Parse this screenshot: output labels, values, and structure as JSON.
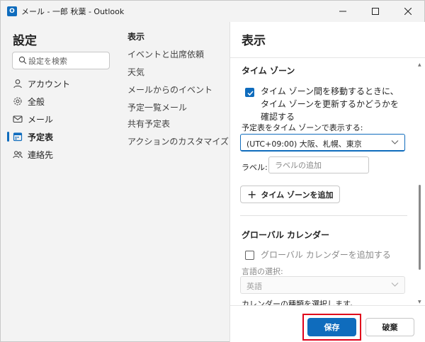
{
  "window": {
    "title": "メール - 一郎 秋葉 - Outlook",
    "app_icon_letter": "O",
    "minimize_icon": "minimize-icon",
    "maximize_icon": "maximize-icon",
    "close_icon": "close-icon"
  },
  "nav": {
    "title": "設定",
    "search_placeholder": "設定を検索",
    "items": [
      {
        "label": "アカウント",
        "icon": "person-icon"
      },
      {
        "label": "全般",
        "icon": "gear-icon"
      },
      {
        "label": "メール",
        "icon": "mail-icon"
      },
      {
        "label": "予定表",
        "icon": "calendar-icon",
        "selected": true
      },
      {
        "label": "連絡先",
        "icon": "people-icon"
      }
    ]
  },
  "subnav": {
    "items": [
      {
        "label": "表示",
        "selected": true
      },
      {
        "label": "イベントと出席依頼"
      },
      {
        "label": "天気"
      },
      {
        "label": "メールからのイベント"
      },
      {
        "label": "予定一覧メール"
      },
      {
        "label": "共有予定表"
      },
      {
        "label": "アクションのカスタマイズ"
      }
    ]
  },
  "content": {
    "title": "表示",
    "timezone": {
      "heading": "タイム ゾーン",
      "move_checkbox_label": "タイム ゾーン間を移動するときに、タイム ゾーンを更新するかどうかを確認する",
      "move_checkbox_checked": true,
      "display_label": "予定表をタイム ゾーンで表示する:",
      "selected_timezone": "(UTC+09:00) 大阪、札幌、東京",
      "label_field_label": "ラベル:",
      "label_placeholder": "ラベルの追加",
      "add_button": "タイム ゾーンを追加"
    },
    "global_calendar": {
      "heading": "グローバル カレンダー",
      "add_checkbox_label": "グローバル カレンダーを追加する",
      "add_checkbox_checked": false,
      "language_label": "言語の選択:",
      "language_value": "英語",
      "calendar_type_label": "カレンダーの種類を選択します。"
    }
  },
  "footer": {
    "save_label": "保存",
    "cancel_label": "破棄"
  },
  "colors": {
    "accent": "#0f6cbd",
    "highlight": "#e0001b"
  }
}
